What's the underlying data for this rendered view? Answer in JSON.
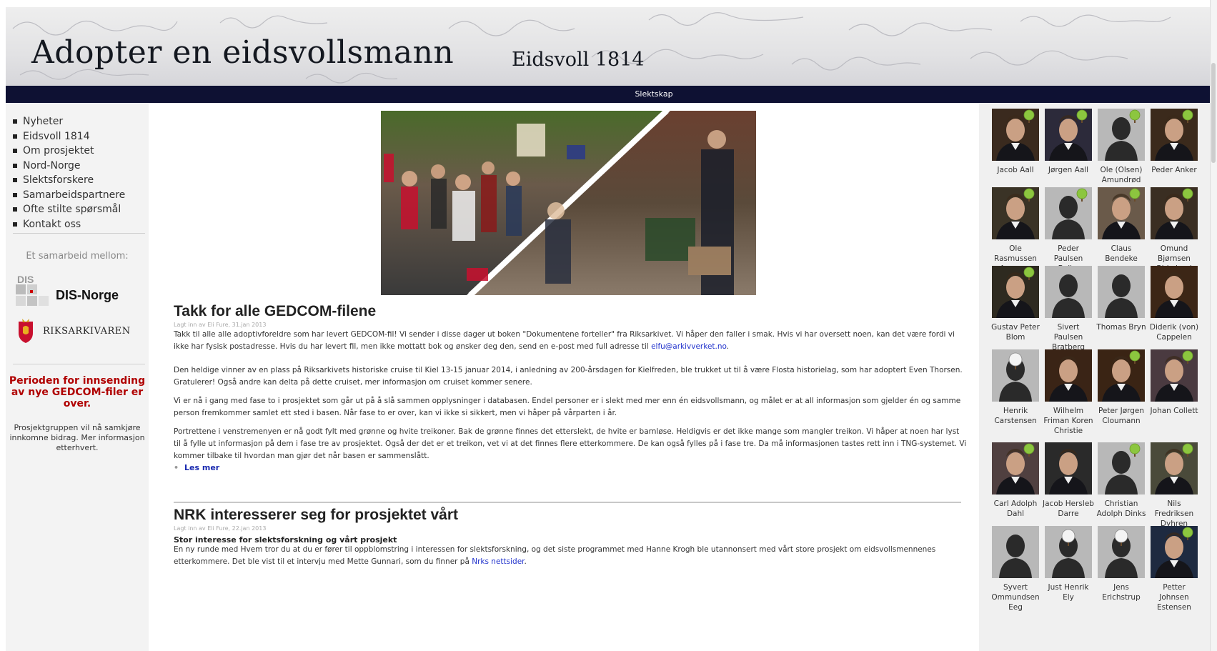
{
  "header": {
    "title": "Adopter en eidsvollsmann",
    "subtitle": "Eidsvoll 1814"
  },
  "navbar": {
    "label": "Slektskap"
  },
  "menu": [
    "Nyheter",
    "Eidsvoll 1814",
    "Om prosjektet",
    "Nord-Norge",
    "Slektsforskere",
    "Samarbeidspartnere",
    "Ofte stilte spørsmål",
    "Kontakt oss"
  ],
  "sidebar": {
    "partners_label": "Et samarbeid mellom:",
    "dis_label": "DIS-Norge",
    "dis_mark": "DIS",
    "ra_label": "RIKSARKIVAREN",
    "notice_title": "Perioden for innsending av nye GEDCOM-filer er over.",
    "notice_body": "Prosjektgruppen vil nå samkjøre innkomne bidrag. Mer informasjon etterhvert."
  },
  "article1": {
    "title": "Takk for alle GEDCOM-filene",
    "meta": "Lagt inn av Eli Fure, 31.jan 2013",
    "p1_text": "Takk til alle alle adoptivforeldre som har levert GEDCOM-fil! Vi sender i disse dager ut boken \"Dokumentene forteller\" fra Riksarkivet. Vi håper den faller i smak. Hvis vi har oversett noen, kan det være fordi vi ikke har fysisk postadresse. Hvis du har levert fil, men ikke mottatt bok og ønsker deg den, send en e-post med full adresse til ",
    "p1_link": "elfu@arkivverket.no",
    "p1_end": ".",
    "p2": "Den heldige vinner av en plass på Riksarkivets historiske  cruise til Kiel 13-15 januar 2014, i anledning av 200-årsdagen for Kielfreden, ble trukket ut til å være Flosta historielag, som har adoptert Even Thorsen. Gratulerer! Også andre kan delta på dette cruiset, mer informasjon om cruiset kommer senere.",
    "p3": "Vi er nå i gang med fase to i prosjektet som går ut på å slå sammen opplysninger i databasen. Endel personer er i slekt med mer enn én eidsvollsmann, og målet er at all informasjon som gjelder én og samme person fremkommer samlet ett sted i basen. Når fase to er over, kan vi ikke si sikkert, men vi håper på vårparten i år.",
    "p4": "Portrettene i venstremenyen er nå godt fylt med grønne og hvite treikoner. Bak de grønne finnes det etterslekt, de hvite er barnløse. Heldigvis er det ikke mange som mangler treikon. Vi håper at noen har lyst til å fylle ut informasjon på dem i fase tre av prosjektet. Også der det er et treikon, vet vi at det finnes flere etterkommere. De kan også fylles på i fase tre. Da må informasjonen tastes rett inn i TNG-systemet. Vi kommer tilbake til hvordan man gjør det når basen er sammenslått.",
    "read_more": "Les mer"
  },
  "article2": {
    "title": "NRK interesserer seg for prosjektet vårt",
    "meta": "Lagt inn av Eli Fure, 22.jan 2013",
    "subhead": "Stor interesse for slektsforskning og vårt prosjekt",
    "p1_text": "En ny runde med Hvem tror du at du er fører til oppblomstring i interessen for slektsforskning, og det siste programmet med Hanne Krogh ble utannonsert med vårt store prosjekt om eidsvollsmennenes etterkommere. Det ble vist til et intervju med Mette Gunnari, som du finner på ",
    "p1_link": "Nrks nettsider",
    "p1_end": "."
  },
  "portraits": [
    {
      "name": "Jacob Aall",
      "kind": "photo",
      "tree": "green",
      "tone": "#3a2a1e"
    },
    {
      "name": "Jørgen Aall",
      "kind": "photo",
      "tree": "green",
      "tone": "#2c2a3a"
    },
    {
      "name": "Ole (Olsen) Amundrød",
      "kind": "silhouette",
      "tree": "green",
      "tone": "#222"
    },
    {
      "name": "Peder Anker",
      "kind": "photo",
      "tree": "green",
      "tone": "#3b2a1c"
    },
    {
      "name": "Ole Rasmussen Apeness",
      "kind": "photo",
      "tree": "green",
      "tone": "#3a3326"
    },
    {
      "name": "Peder Paulsen Balke",
      "kind": "silhouette",
      "tree": "green",
      "tone": "#222"
    },
    {
      "name": "Claus Bendeke",
      "kind": "photo",
      "tree": "green",
      "tone": "#6a5a4a"
    },
    {
      "name": "Omund Bjørnsen Birkeland",
      "kind": "photo",
      "tree": "green",
      "tone": "#3a2e22"
    },
    {
      "name": "Gustav Peter Blom",
      "kind": "photo",
      "tree": "green",
      "tone": "#2e2a20"
    },
    {
      "name": "Sivert Paulsen Bratberg",
      "kind": "silhouette",
      "tree": "none",
      "tone": "#222"
    },
    {
      "name": "Thomas Bryn",
      "kind": "silhouette",
      "tree": "none",
      "tone": "#222"
    },
    {
      "name": "Diderik (von) Cappelen",
      "kind": "photo",
      "tree": "none",
      "tone": "#3c2616"
    },
    {
      "name": "Henrik Carstensen",
      "kind": "silhouette",
      "tree": "white",
      "tone": "#222"
    },
    {
      "name": "Wilhelm Friman Koren Christie",
      "kind": "photo",
      "tree": "none",
      "tone": "#3a2416"
    },
    {
      "name": "Peter Jørgen Cloumann",
      "kind": "photo",
      "tree": "green",
      "tone": "#3a2414"
    },
    {
      "name": "Johan Collett",
      "kind": "photo",
      "tree": "green",
      "tone": "#4a3a40"
    },
    {
      "name": "Carl Adolph Dahl",
      "kind": "photo",
      "tree": "green",
      "tone": "#504040"
    },
    {
      "name": "Jacob Hersleb Darre",
      "kind": "photo",
      "tree": "none",
      "tone": "#2a2a2a"
    },
    {
      "name": "Christian Adolph Dinks",
      "kind": "silhouette",
      "tree": "green",
      "tone": "#222"
    },
    {
      "name": "Nils Fredriksen Dyhren",
      "kind": "photo",
      "tree": "green",
      "tone": "#4a4a3a"
    },
    {
      "name": "Syvert Ommundsen Eeg",
      "kind": "silhouette",
      "tree": "none",
      "tone": "#222"
    },
    {
      "name": "Just Henrik Ely",
      "kind": "silhouette",
      "tree": "white",
      "tone": "#222"
    },
    {
      "name": "Jens Erichstrup",
      "kind": "silhouette",
      "tree": "white",
      "tone": "#222"
    },
    {
      "name": "Petter Johnsen Estensen",
      "kind": "photo",
      "tree": "green",
      "tone": "#1e2a40"
    }
  ]
}
